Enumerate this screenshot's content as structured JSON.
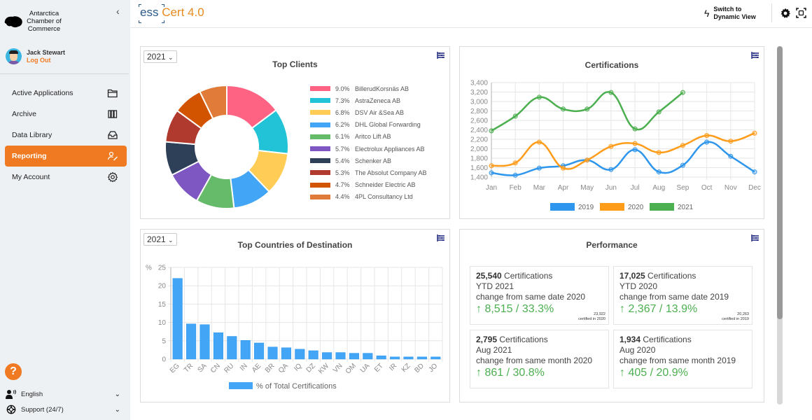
{
  "sidebar": {
    "org_name": "Antarctica Chamber of Commerce",
    "user_name": "Jack Stewart",
    "logout_label": "Log Out",
    "nav": [
      {
        "label": "Active Applications",
        "icon": "folder-icon",
        "active": false
      },
      {
        "label": "Archive",
        "icon": "books-icon",
        "active": false
      },
      {
        "label": "Data Library",
        "icon": "inbox-icon",
        "active": false
      },
      {
        "label": "Reporting",
        "icon": "user-edit-icon",
        "active": true
      },
      {
        "label": "My Account",
        "icon": "gear-icon",
        "active": false
      }
    ],
    "help_label": "?",
    "language_label": "English",
    "support_label": "Support (24/7)"
  },
  "topbar": {
    "brand_ess": "ess",
    "brand_cert": "Cert 4.0",
    "switch_line1": "Switch to",
    "switch_line2": "Dynamic View"
  },
  "colors": {
    "accent": "#f07a22",
    "series_2019": "#2f96ed",
    "series_2020": "#ff9c1a",
    "series_2021": "#4caf50",
    "bar": "#42a5f5",
    "positive": "#4caf50"
  },
  "top_clients": {
    "year": "2021",
    "title": "Top Clients"
  },
  "certifications": {
    "title": "Certifications"
  },
  "countries": {
    "year": "2021",
    "title": "Top Countries of Destination"
  },
  "performance": {
    "title": "Performance",
    "cards": [
      {
        "count": "25,540",
        "unit": "Certifications",
        "period": "YTD 2021",
        "compare": "change from same date 2020",
        "change": "↑ 8,515 / 33.3%",
        "foot_value": "23,922",
        "foot_label": "certified in 2020"
      },
      {
        "count": "17,025",
        "unit": "Certifications",
        "period": "YTD 2020",
        "compare": "change from same date 2019",
        "change": "↑ 2,367 / 13.9%",
        "foot_value": "20,263",
        "foot_label": "certified in 2019"
      },
      {
        "count": "2,795",
        "unit": "Certifications",
        "period": "Aug 2021",
        "compare": "change from same month 2020",
        "change": "↑ 861 / 30.8%",
        "foot_value": "",
        "foot_label": ""
      },
      {
        "count": "1,934",
        "unit": "Certifications",
        "period": "Aug 2020",
        "compare": "change from same month 2019",
        "change": "↑ 405 / 20.9%",
        "foot_value": "",
        "foot_label": ""
      }
    ]
  },
  "chart_data": [
    {
      "type": "pie",
      "title": "Top Clients",
      "donut": true,
      "labels": [
        "BillerudKorsnäs AB",
        "AstraZeneca AB",
        "DSV Air &Sea AB",
        "DHL Global Forwarding",
        "Aritco Lift AB",
        "Electrolux Appliances AB",
        "Schenker AB",
        "The Absolut Company AB",
        "Schneider Electric AB",
        "4PL Consultancy Ltd"
      ],
      "pct_labels": [
        "9.0%",
        "7.3%",
        "6.8%",
        "6.2%",
        "6.1%",
        "5.7%",
        "5.4%",
        "5.3%",
        "4.7%",
        "4.4%"
      ],
      "values": [
        9.0,
        7.3,
        6.8,
        6.2,
        6.1,
        5.7,
        5.4,
        5.3,
        4.7,
        4.4
      ],
      "colors": [
        "#ff6384",
        "#22c3d6",
        "#ffcd56",
        "#42a5f5",
        "#66bb6a",
        "#7e57c2",
        "#2e4057",
        "#b03a2e",
        "#d35400",
        "#e07b39"
      ],
      "legend": "right"
    },
    {
      "type": "line",
      "title": "Certifications",
      "categories": [
        "Jan",
        "Feb",
        "Mar",
        "Apr",
        "May",
        "Jun",
        "Jul",
        "Aug",
        "Sep",
        "Oct",
        "Nov",
        "Dec"
      ],
      "series": [
        {
          "name": "2019",
          "values": [
            1490,
            1440,
            1590,
            1640,
            1760,
            1560,
            1980,
            1510,
            1650,
            2140,
            1840,
            1510
          ]
        },
        {
          "name": "2020",
          "values": [
            1640,
            1700,
            2140,
            1590,
            1760,
            2050,
            2110,
            1920,
            2070,
            2280,
            2160,
            2330
          ]
        },
        {
          "name": "2021",
          "values": [
            2380,
            2690,
            3090,
            2840,
            2840,
            3190,
            2420,
            2780,
            3190
          ]
        }
      ],
      "yticks": [
        "3,400",
        "3,200",
        "3,000",
        "2,800",
        "2,600",
        "2,400",
        "2,200",
        "2,000",
        "1,800",
        "1,600",
        "1,400"
      ],
      "ylim": [
        1400,
        3400
      ],
      "grid": true,
      "legend": "bottom"
    },
    {
      "type": "bar",
      "title": "Top Countries of Destination",
      "categories": [
        "EG",
        "TR",
        "SA",
        "CN",
        "RU",
        "IN",
        "AE",
        "BR",
        "QA",
        "IQ",
        "DZ",
        "KW",
        "VN",
        "OM",
        "UA",
        "ET",
        "IR",
        "KZ",
        "BD",
        "JO"
      ],
      "values": [
        22,
        9.6,
        9.4,
        7.2,
        6.2,
        5.1,
        4.4,
        3.3,
        3.1,
        2.7,
        2.3,
        1.8,
        1.8,
        1.6,
        1.6,
        0.9,
        0.6,
        0.6,
        0.6,
        0.6
      ],
      "ylabel": "%",
      "yticks": [
        "25",
        "20",
        "15",
        "10",
        "5",
        "0"
      ],
      "ylim": [
        0,
        25
      ],
      "legend_label": "% of Total Certifications",
      "grid": true,
      "legend": "bottom"
    }
  ]
}
